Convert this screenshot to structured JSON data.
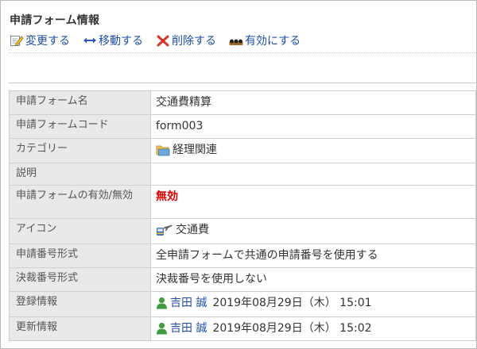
{
  "page": {
    "title": "申請フォーム情報"
  },
  "toolbar": {
    "edit_label": "変更する",
    "move_label": "移動する",
    "delete_label": "削除する",
    "enable_label": "有効にする"
  },
  "details": {
    "form_name": {
      "label": "申請フォーム名",
      "value": "交通費精算"
    },
    "form_code": {
      "label": "申請フォームコード",
      "value": "form003"
    },
    "category": {
      "label": "カテゴリー",
      "value": "経理関連"
    },
    "description": {
      "label": "説明",
      "value": ""
    },
    "status": {
      "label": "申請フォームの有効/無効",
      "value": "無効"
    },
    "icon": {
      "label": "アイコン",
      "value": "交通費"
    },
    "number_format": {
      "label": "申請番号形式",
      "value": "全申請フォームで共通の申請番号を使用する"
    },
    "approval_number_format": {
      "label": "決裁番号形式",
      "value": "決裁番号を使用しない"
    },
    "registered": {
      "label": "登録情報",
      "user": "吉田 誠",
      "datetime": "2019年08月29日（木） 15:01"
    },
    "updated": {
      "label": "更新情報",
      "user": "吉田 誠",
      "datetime": "2019年08月29日（木） 15:02"
    }
  },
  "icons": {
    "edit": "edit-icon",
    "move": "move-arrows-icon",
    "delete": "delete-x-icon",
    "enable": "enable-icon",
    "category": "folder-icon",
    "form_icon": "transport-icon",
    "user": "user-icon"
  },
  "colors": {
    "link": "#1f4ea8",
    "label_bg": "#e9e9e9",
    "status_invalid": "#e00000",
    "border": "#cfcfcf"
  }
}
